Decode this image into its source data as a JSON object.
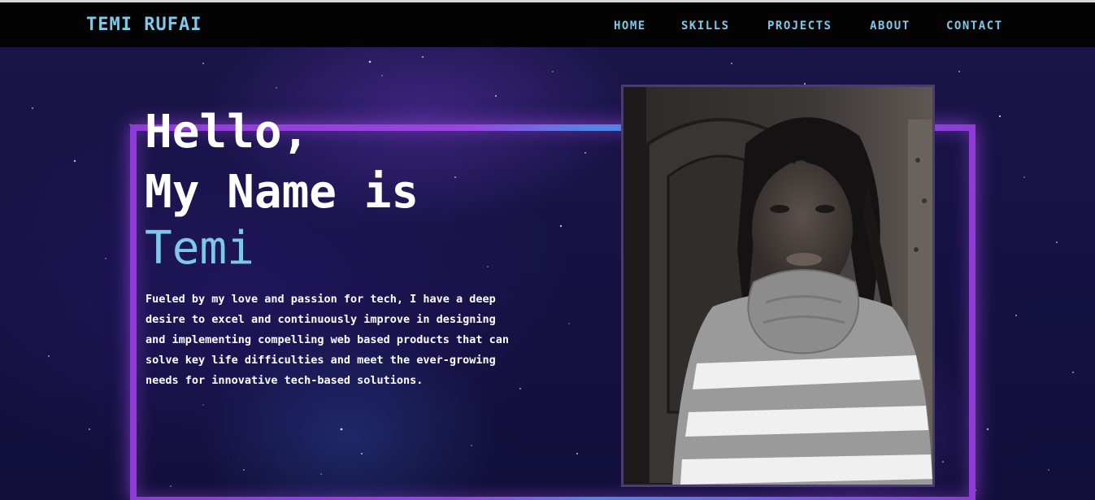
{
  "navbar": {
    "brand": "TEMI RUFAI",
    "links": [
      "HOME",
      "SKILLS",
      "PROJECTS",
      "ABOUT",
      "CONTACT"
    ]
  },
  "hero": {
    "greeting_line1": "Hello,",
    "greeting_line2": "My Name is",
    "name": "Temi",
    "bio": "Fueled by my love and passion for tech, I have a deep desire to excel and continuously improve in designing and implementing compelling web based products that can solve key life difficulties and meet the ever-growing needs for innovative tech-based solutions."
  },
  "colors": {
    "accent": "#7ec8e8",
    "navbar_bg": "#030303",
    "hero_bg": "#161246",
    "neon_purple": "#9b45e0",
    "neon_blue": "#4f86e6",
    "photo_border": "#4a3d6e"
  }
}
